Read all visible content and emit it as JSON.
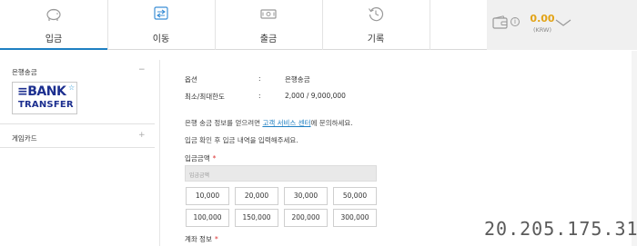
{
  "nav": {
    "tabs": [
      {
        "label": "입금",
        "icon": "piggy-bank-icon",
        "active": true
      },
      {
        "label": "이동",
        "icon": "transfer-icon",
        "active": false
      },
      {
        "label": "출금",
        "icon": "cash-icon",
        "active": false
      },
      {
        "label": "기록",
        "icon": "history-icon",
        "active": false
      }
    ]
  },
  "wallet": {
    "amount": "0.00",
    "currency": "(KRW)",
    "info": "i",
    "accent_color": "#e2a316"
  },
  "sidebar": {
    "section_title": "은행송금",
    "collapse_symbol": "−",
    "logo_line1": "≡BANK",
    "logo_line2": "TRANSFER",
    "item2_label": "게임카드",
    "expand_symbol": "+"
  },
  "main": {
    "option_label": "옵션",
    "option_value": "은행송금",
    "limit_label": "최소/최대한도",
    "limit_value": "2,000 / 9,000,000",
    "colon": ":",
    "notice1_pre": "은행 송금 정보를 얻으려면 ",
    "notice1_link": "고객 서비스 센터",
    "notice1_post": "에 문의하세요.",
    "notice2": "입금 확인 후 입금 내역을 입력해주세요.",
    "amount_label": "입금금액",
    "required_mark": "*",
    "amount_placeholder": "입금금액",
    "quick_amounts": [
      "10,000",
      "20,000",
      "30,000",
      "50,000",
      "100,000",
      "150,000",
      "200,000",
      "300,000"
    ],
    "account_label": "계좌 정보"
  },
  "watermark": "20.205.175.31",
  "colors": {
    "link": "#1e7fc2",
    "brand_blue": "#1c2f8f",
    "required": "#d33333"
  }
}
